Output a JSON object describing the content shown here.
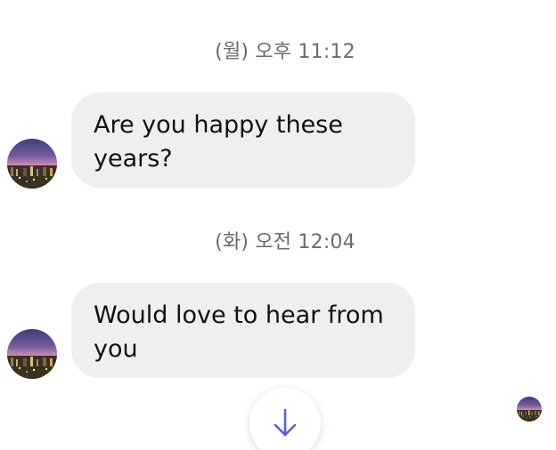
{
  "messages": [
    {
      "timestamp": "(월) 오후 11:12",
      "text": "Are you happy these years?"
    },
    {
      "timestamp": "(화) 오전 12:04",
      "text": "Would love to hear from you"
    }
  ],
  "icons": {
    "avatar": "avatar-photo",
    "read_receipt": "seen-avatar",
    "scroll": "arrow-down-icon"
  },
  "colors": {
    "bubble": "#efefef",
    "timestamp": "#6b6b6b",
    "accent": "#5b5bf0"
  }
}
